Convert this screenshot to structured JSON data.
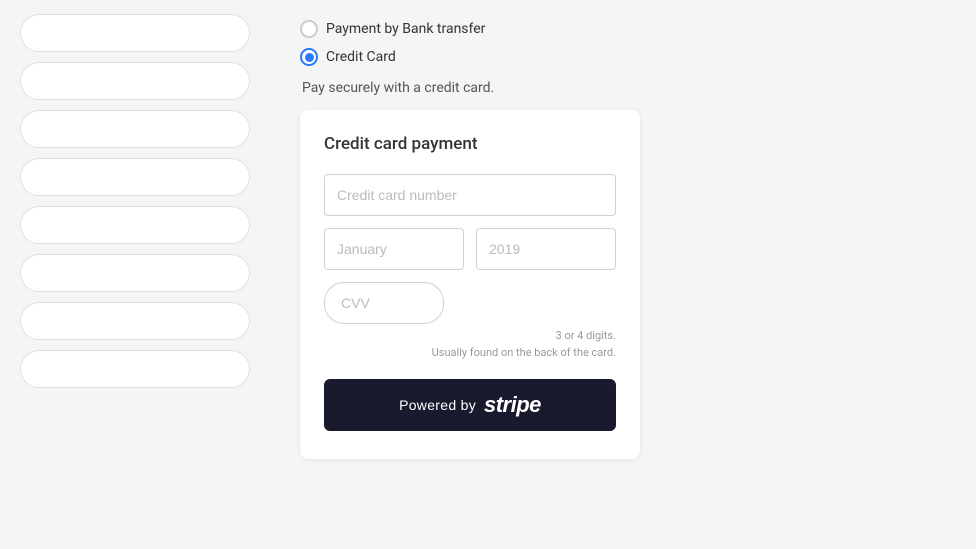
{
  "sidebar": {
    "pills": [
      {
        "id": "pill-1"
      },
      {
        "id": "pill-2"
      },
      {
        "id": "pill-3"
      },
      {
        "id": "pill-4"
      },
      {
        "id": "pill-5"
      },
      {
        "id": "pill-6"
      },
      {
        "id": "pill-7"
      },
      {
        "id": "pill-8"
      }
    ]
  },
  "payment": {
    "option_bank": "Payment by Bank transfer",
    "option_card": "Credit Card",
    "subtitle": "Pay securely with a credit card.",
    "card_title": "Credit card payment",
    "fields": {
      "card_number_placeholder": "Credit card number",
      "month_placeholder": "January",
      "year_placeholder": "2019",
      "cvv_placeholder": "CVV",
      "cvv_hint_line1": "3 or 4 digits.",
      "cvv_hint_line2": "Usually found on the back of the card."
    },
    "stripe_button": {
      "powered_by": "Powered by",
      "stripe": "stripe"
    }
  }
}
